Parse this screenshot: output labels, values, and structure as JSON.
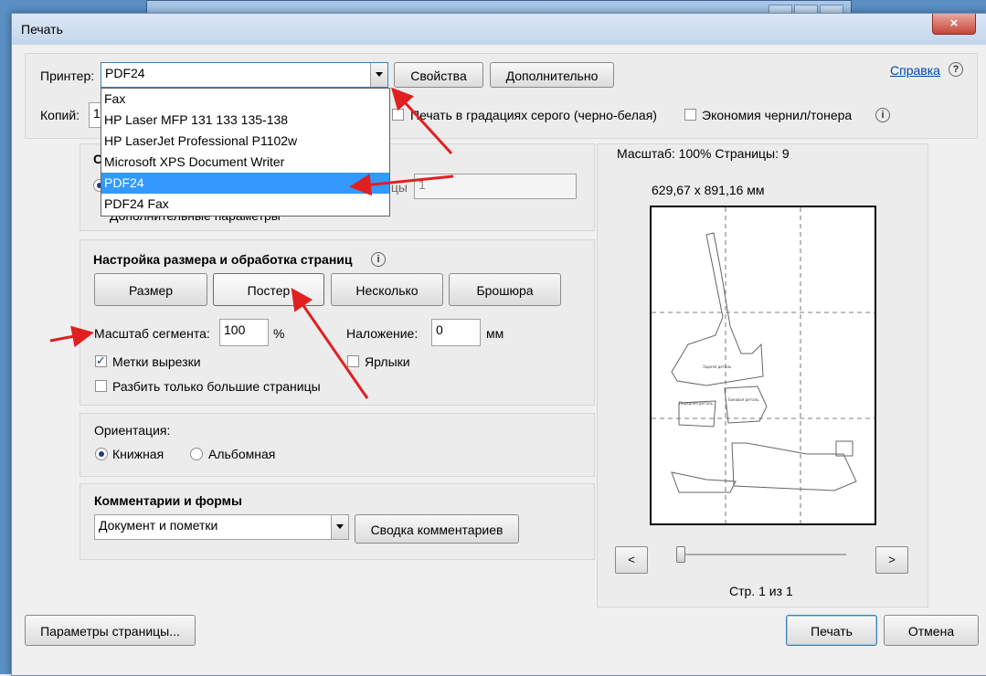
{
  "dialog": {
    "title": "Печать",
    "close_icon": "×",
    "help_link": "Справка",
    "help_icon": "?",
    "printer_label": "Принтер:",
    "printer_value": "PDF24",
    "properties_btn": "Свойства",
    "advanced_btn": "Дополнительно",
    "copies_label": "Копий:",
    "copies_value": "1",
    "grayscale_label": "Печать в градациях серого (черно-белая)",
    "save_ink_label": "Экономия чернил/тонера",
    "printer_options": [
      {
        "label": "Fax",
        "selected": false
      },
      {
        "label": "HP Laser MFP 131 133 135-138",
        "selected": false
      },
      {
        "label": "HP LaserJet Professional P1102w",
        "selected": false
      },
      {
        "label": "Microsoft XPS Document Writer",
        "selected": false
      },
      {
        "label": "PDF24",
        "selected": true
      },
      {
        "label": "PDF24 Fax",
        "selected": false
      }
    ],
    "pages_section": {
      "heading_partial": "С",
      "pages_partial": "ицы",
      "pages_value": "1",
      "more_options_partial": "Дополнительные параметры"
    },
    "sizing": {
      "heading": "Настройка размера и обработка страниц",
      "tabs": [
        "Размер",
        "Постер",
        "Несколько",
        "Брошюра"
      ],
      "tile_scale_label": "Масштаб сегмента:",
      "tile_scale_value": "100",
      "tile_scale_unit": "%",
      "overlap_label": "Наложение:",
      "overlap_value": "0",
      "overlap_unit": "мм",
      "cut_marks_label": "Метки вырезки",
      "cut_marks_checked": true,
      "labels_label": "Ярлыки",
      "labels_checked": false,
      "tile_large_label": "Разбить только большие страницы",
      "tile_large_checked": false
    },
    "orientation": {
      "heading": "Ориентация:",
      "portrait": "Книжная",
      "landscape": "Альбомная",
      "selected": "portrait"
    },
    "comments": {
      "heading": "Комментарии и формы",
      "value": "Документ и пометки",
      "summary_btn": "Сводка комментариев"
    },
    "preview": {
      "scale_text": "Масштаб: 100% Страницы: 9",
      "dimensions": "629,67 x 891,16 мм",
      "prev_icon": "<",
      "next_icon": ">",
      "page_counter": "Стр. 1 из 1",
      "pattern_labels": [
        "Передняя деталь",
        "Боковая деталь",
        "Задняя деталь"
      ]
    },
    "page_setup_btn": "Параметры страницы...",
    "print_btn": "Печать",
    "cancel_btn": "Отмена",
    "accent_color": "#3399ff",
    "annotation_color": "#e02020"
  }
}
